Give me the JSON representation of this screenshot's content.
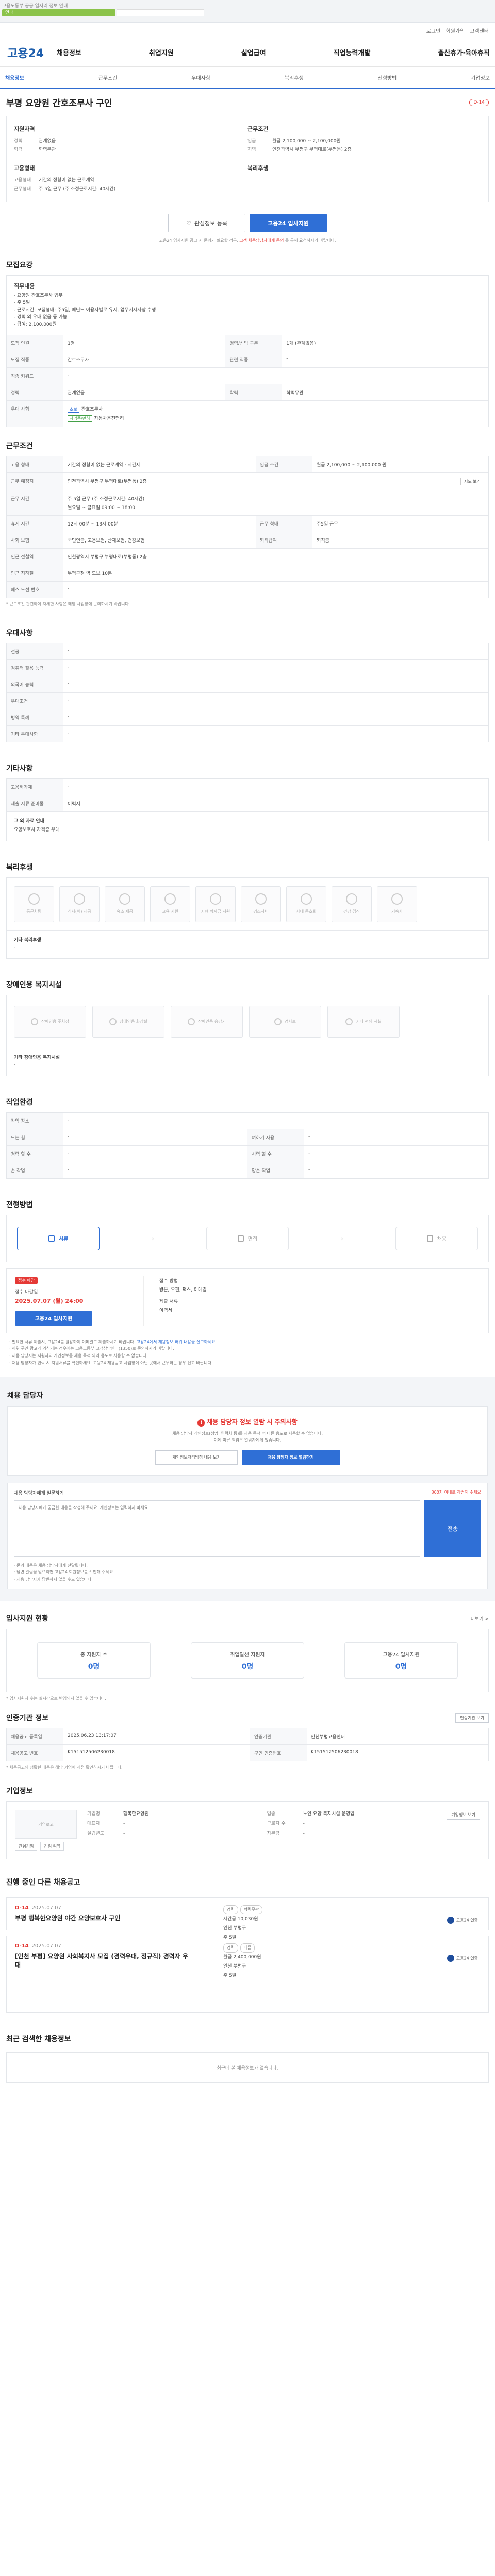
{
  "top": {
    "notice": "고용노동부 공공 일자리 정보 안내",
    "green_label": "안내"
  },
  "util": [
    "로그인",
    "회원가입",
    "고객센터"
  ],
  "gnb": {
    "logo": "고용24",
    "menu": [
      "채용정보",
      "취업지원",
      "실업급여",
      "직업능력개발",
      "출산휴가·육아휴직"
    ]
  },
  "subnav": [
    "채용정보",
    "근무조건",
    "우대사항",
    "복리후생",
    "전형방법",
    "기업정보"
  ],
  "job": {
    "title": "부평 요양원 간호조무사 구인",
    "dday": "D-14",
    "qual_head": "지원자격",
    "qual": [
      [
        "경력",
        "관계없음"
      ],
      [
        "학력",
        "학력무관"
      ]
    ],
    "cond_head": "근무조건",
    "cond": [
      [
        "임금",
        "월급 2,100,000 ~ 2,100,000원"
      ],
      [
        "지역",
        "인천광역시 부평구 부평대로(부평동) 2층"
      ]
    ],
    "place_head": "고용형태",
    "place": [
      [
        "고용형태",
        "기간의 정함이 없는 근로계약"
      ],
      [
        "근무형태",
        "주 5일 근무 (주 소정근로시간: 40시간)"
      ]
    ],
    "welfare_head": "복리후생"
  },
  "buttons": {
    "scrap": "관심정보 등록",
    "apply": "고용24 입사지원"
  },
  "hint": {
    "text": "고용24 입사지원 공고 시 문의가 필요할 경우,",
    "red": "고객 채용담당자에게 문의",
    "tail": "를 통해 요청하시기 바랍니다."
  },
  "sec_duty": {
    "head": "모집요강",
    "duty_title": "직무내용",
    "duty_lines": [
      "- 요양원 간호조무사 업무",
      "- 주 5일",
      "- 근로시간, 모집형태: 주5일, 매년도 이용자별로 유지, 업무지시사항 수행",
      "- 경력 외 우대 없음 등 가능",
      "- 급여: 2,100,000원"
    ],
    "rows": [
      [
        "모집 인원",
        "1명",
        "경력/신입 구분",
        "1개 (관계없음)"
      ],
      [
        "모집 직종",
        "간호조무사",
        "관련 직종",
        "-"
      ],
      [
        "직종 키워드",
        "-",
        "",
        ""
      ],
      [
        "경력",
        "관계없음",
        "학력",
        "학력무관"
      ],
      [
        "우대 사항",
        "-",
        "",
        ""
      ]
    ],
    "tag1": "초보",
    "tag2": "자격증/면허",
    "cert1": "간호조무사",
    "cert2": "자동차운전면허"
  },
  "sec_cond": {
    "head": "근무조건",
    "rows": [
      [
        "고용 형태",
        "기간의 정함이 없는 근로계약 · 시간제",
        "임금 조건",
        "월급 2,100,000 ~ 2,100,000 원"
      ],
      [
        "근무 예정지",
        "",
        "",
        ""
      ],
      [
        "근무 시간",
        "주 5일 근무 (주 소정근로시간: 40시간)",
        "",
        ""
      ],
      [
        "근로 시간 요일",
        "",
        "",
        ""
      ],
      [
        "휴게 시간",
        "12시 00분 ~ 13시 00분",
        "근무 형태",
        "주5일 근무"
      ],
      [
        "사회 보험",
        "국민연금, 고용보험, 산재보험, 건강보험",
        "퇴직급여",
        "퇴직금"
      ],
      [
        "인근 전철역",
        "인천광역시 부평구 부평대로(부평동) 2층",
        "",
        ""
      ],
      [
        "인근 지하철",
        "부평구청 역 도보 10분",
        "",
        ""
      ],
      [
        "혜스 노선 번호",
        "-",
        "",
        ""
      ]
    ],
    "workplace": "인천광역시 부평구 부평대로(부평동) 2층",
    "map_btn": "지도 보기",
    "schedule": "월요일 ~ 금요일 09:00 ~ 18:00",
    "note": "* 근로조건 관련하여 자세한 사항은 해당 사업장에 문의하시기 바랍니다."
  },
  "sec_pref": {
    "head": "우대사항",
    "rows": [
      [
        "전공",
        "-"
      ],
      [
        "컴퓨터 활용 능력",
        "-"
      ],
      [
        "외국어 능력",
        "-"
      ],
      [
        "우대조건",
        "-"
      ],
      [
        "병역 특례",
        "-"
      ],
      [
        "기타 우대사항",
        "-"
      ]
    ]
  },
  "sec_etc": {
    "head": "기타사항",
    "rows": [
      [
        "고용허가제",
        "-"
      ],
      [
        "제출 서류 준비물",
        "이력서"
      ]
    ],
    "extra_label": "그 외 자료 안내",
    "extra_value": "요양보호사 자격증 우대"
  },
  "sec_welfare": {
    "head": "복리후생",
    "items": [
      "통근차량",
      "식사(비) 제공",
      "숙소 제공",
      "교육 지원",
      "자녀 학자금 지원",
      "경조사비",
      "사내 동호회",
      "건강 검진",
      "기숙사"
    ],
    "etc_label": "기타 복리후생",
    "etc_value": "-"
  },
  "sec_dis": {
    "head": "장애인용 복지시설",
    "items": [
      "장애인용 주차장",
      "장애인용 화장실",
      "장애인용 승강기",
      "경사로",
      "기타 편의 시설"
    ],
    "etc_label": "기타 장애인용 복지시설",
    "etc_value": "-"
  },
  "sec_env": {
    "head": "작업환경",
    "rows": [
      [
        "작업 장소",
        "-",
        "",
        ""
      ],
      [
        "드는 힘",
        "-",
        "여하기 사용",
        "-"
      ],
      [
        "청력 할 수",
        "-",
        "시력 할 수",
        "-"
      ],
      [
        "손 작업",
        "-",
        "양손 작업",
        "-"
      ]
    ]
  },
  "sec_process": {
    "head": "전형방법",
    "steps": [
      "서류",
      "면접",
      "채용"
    ],
    "chip": "접수 마감",
    "deadline_label": "접수 마감일",
    "deadline": "2025.07.07 (월) 24:00",
    "apply_btn": "고용24 입사지원",
    "method_label": "접수 방법",
    "method": "방문, 우편, 팩스, 이메일",
    "docs_label": "제출 서류",
    "docs": "이력서"
  },
  "notes": {
    "l1": "· 필요한 서류 제출시, 고용24를 활용하여 이메일로 제출하시기 바랍니다. ",
    "l1b": "고용24에서 채용정보 허위 내용을 신고하세요.",
    "l2": "· 허위 구인 광고가 의심되는 경우에는 고용노동부 고객상담센터(1350)로 문의하시기 바랍니다.",
    "l3": "· 채용 담당자는 지원자의 개인정보를 채용 목적 외의 용도로 사용할 수 없습니다.",
    "l4": "· 채용 담당자가 연락 시 지원서류를 확인하세요. 고용24 채용공고 사업장이 아닌 곳에서 근무하는 경우 신고 바랍니다."
  },
  "inquiry": {
    "head": "채용 담당자",
    "warn": "채용 담당자 정보 열람 시 주의사항",
    "desc1": "채용 담당자 개인정보(성명, 연락처 등)를 채용 목적 외 다른 용도로 사용할 수 없습니다.",
    "desc2": "이에 따른 책임은 열람자에게 있습니다.",
    "btn1": "개인정보처리방침 내용 보기",
    "btn2": "채용 담당자 정보 열람하기",
    "q_head": "채용 담당자에게 질문하기",
    "q_right": "300자 이내로 작성해 주세요",
    "q_placeholder": "채용 담당자에게 궁금한 내용을 작성해 주세요. 개인정보는 입력하지 마세요.",
    "send": "전송",
    "qn1": "· 문의 내용은 채용 담당자에게 전달됩니다.",
    "qn2": "· 답변 알림을 받으려면 고용24 회원정보를 확인해 주세요.",
    "qn3": "· 채용 담당자가 답변하지 않을 수도 있습니다."
  },
  "status": {
    "head": "입사지원 현황",
    "more": "더보기 >",
    "stats": [
      [
        "총 지원자 수",
        "0명"
      ],
      [
        "취업알선 지원자",
        "0명"
      ],
      [
        "고용24 입사지원",
        "0명"
      ]
    ],
    "note": "* 입사지원자 수는 실시간으로 반영되지 않을 수 있습니다."
  },
  "info": {
    "head": "인증기관 정보",
    "btn": "인증기관 보기",
    "rows": [
      [
        "채용공고 등록일",
        "2025.06.23 13:17:07",
        "인증기관",
        "인천부평고용센터"
      ],
      [
        "채용공고 번호",
        "K151512506230018",
        "구인 인증번호",
        "K151512506230018"
      ]
    ],
    "note": "* 채용공고의 정확한 내용은 해당 기업에 직접 확인하시기 바랍니다."
  },
  "org": {
    "head": "기업정보",
    "logo": "기업로고",
    "btn": "기업정보 보기",
    "sub": [
      "관심기업",
      "기업 리뷰"
    ],
    "kvs": [
      [
        "기업명",
        "행복한요양원"
      ],
      [
        "업종",
        "노인 요양 복지시설 운영업"
      ],
      [
        "대표자",
        "-"
      ],
      [
        "근로자 수",
        "-"
      ],
      [
        "설립년도",
        "-"
      ],
      [
        "자본금",
        "-"
      ]
    ]
  },
  "related": {
    "head": "진행 중인 다른 채용공고",
    "cards": [
      {
        "d": "D-14",
        "date": "2025.07.07",
        "title": "부평 행복한요양원 야간 요양보호사 구인",
        "pills": [
          "경력",
          "학력무관"
        ],
        "m1": "시간급 10,030원",
        "m2": "인천 부평구",
        "m3": "주 5일",
        "stamp": "고용24 인증"
      },
      {
        "d": "D-14",
        "date": "2025.07.07",
        "title": "[인천 부평] 요양원 사회복지사 모집 (경력우대, 정규직) 경력자 우대",
        "pills": [
          "경력",
          "대졸"
        ],
        "m1": "월급 2,400,000원",
        "m2": "인천 부평구",
        "m3": "주 5일",
        "stamp": "고용24 인증"
      }
    ]
  },
  "recent": {
    "head": "최근 검색한 채용정보",
    "empty": "최근에 본 채용정보가 없습니다."
  }
}
